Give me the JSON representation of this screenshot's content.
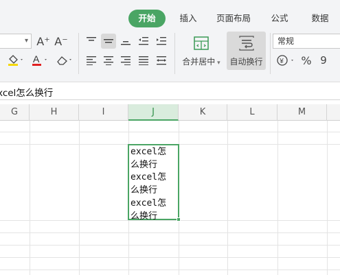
{
  "ribbon": {
    "tabs": [
      {
        "label": "开始",
        "active": true
      },
      {
        "label": "插入",
        "active": false
      },
      {
        "label": "页面布局",
        "active": false
      },
      {
        "label": "公式",
        "active": false
      },
      {
        "label": "数据",
        "active": false
      }
    ],
    "merge_center_label": "合并居中",
    "wrap_text_label": "自动换行",
    "number_format_value": "常规",
    "increase_font_glyph": "A⁺",
    "decrease_font_glyph": "A⁻",
    "percent_glyph": "%",
    "comma_glyph": "9",
    "accent_color": "#4aa564",
    "font_color_bar": "#e02020",
    "fill_color_bar": "#f5d800"
  },
  "formula_bar": {
    "content": "excel怎么换行"
  },
  "sheet": {
    "columns": [
      "G",
      "H",
      "I",
      "J",
      "K",
      "L",
      "M"
    ],
    "selected_column": "J",
    "active_cell_lines": [
      "excel怎",
      "么换行",
      "excel怎",
      "么换行",
      "excel怎",
      "么换行"
    ]
  }
}
